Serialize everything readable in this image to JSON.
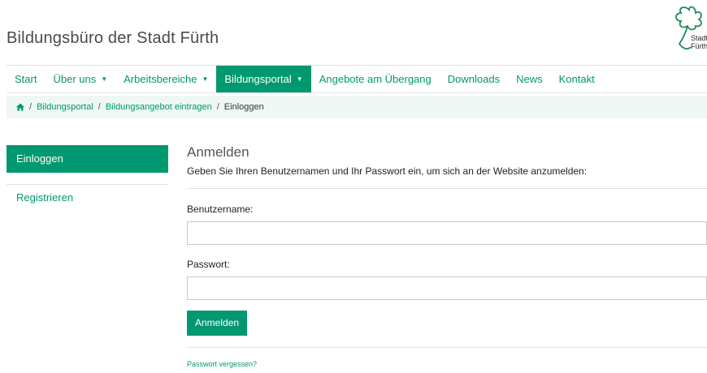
{
  "header": {
    "site_title": "Bildungsbüro der Stadt Fürth",
    "logo_line1": "Stadt",
    "logo_line2": "Fürth"
  },
  "nav": {
    "items": [
      {
        "label": "Start",
        "has_caret": false
      },
      {
        "label": "Über uns",
        "has_caret": true
      },
      {
        "label": "Arbeitsbereiche",
        "has_caret": true
      },
      {
        "label": "Bildungsportal",
        "has_caret": true,
        "active": true
      },
      {
        "label": "Angebote am Übergang",
        "has_caret": false
      },
      {
        "label": "Downloads",
        "has_caret": false
      },
      {
        "label": "News",
        "has_caret": false
      },
      {
        "label": "Kontakt",
        "has_caret": false
      }
    ],
    "caret": "▼"
  },
  "breadcrumb": {
    "items": [
      "Bildungsportal",
      "Bildungsangebot eintragen"
    ],
    "current": "Einloggen",
    "separator": "/"
  },
  "sidebar": {
    "items": [
      {
        "label": "Einloggen",
        "active": true
      },
      {
        "label": "Registrieren",
        "active": false
      }
    ]
  },
  "login": {
    "heading": "Anmelden",
    "intro": "Geben Sie Ihren Benutzernamen und Ihr Passwort ein, um sich an der Website anzumelden:",
    "username_label": "Benutzername:",
    "username_value": "",
    "password_label": "Passwort:",
    "password_value": "",
    "submit_label": "Anmelden",
    "forgot_link": "Passwort vergessen?"
  },
  "colors": {
    "accent": "#009870",
    "breadcrumb_bg": "#eef7f3"
  }
}
